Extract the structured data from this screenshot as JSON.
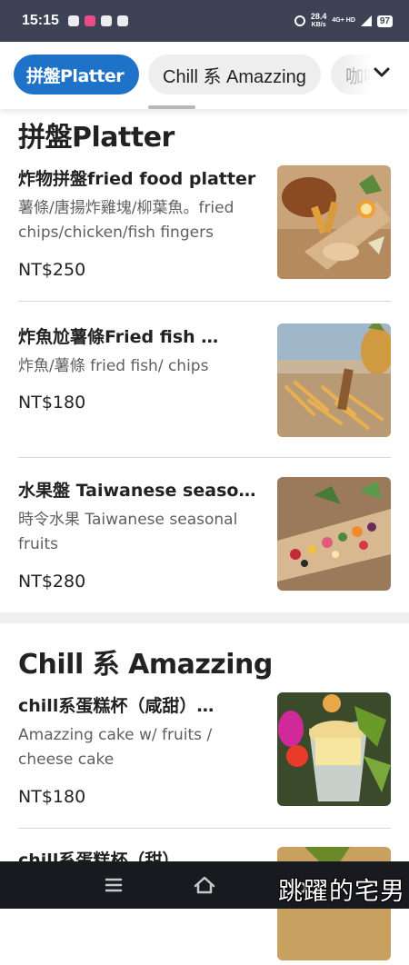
{
  "status_bar": {
    "time": "15:15",
    "net_speed_value": "28.4",
    "net_speed_unit": "KB/s",
    "network": "4G+ HD",
    "battery": "97"
  },
  "categories": {
    "active": "拼盤Platter",
    "second": "Chill 系 Amazzing",
    "third_partial": "咖啡"
  },
  "sections": [
    {
      "title": "拼盤Platter",
      "items": [
        {
          "name": "炸物拼盤fried food platter",
          "desc": "薯條/唐揚炸雞塊/柳葉魚。fried chips/chicken/fish fingers",
          "price": "NT$250"
        },
        {
          "name": "炸魚尬薯條Fried fish & chips",
          "desc": "炸魚/薯條 fried fish/ chips",
          "price": "NT$180"
        },
        {
          "name": "水果盤 Taiwanese seasonal fruits",
          "desc": "時令水果 Taiwanese seasonal fruits",
          "price": "NT$280"
        }
      ]
    },
    {
      "title": "Chill 系 Amazzing",
      "items": [
        {
          "name": "chill系蛋糕杯（咸甜）Amazzing cake",
          "desc": "Amazzing cake w/ fruits / cheese cake",
          "price": "NT$180"
        },
        {
          "name": "chill系蛋糕杯（甜）Amazzing cake",
          "desc": "",
          "price": ""
        }
      ]
    }
  ],
  "watermark": "跳躍的宅男",
  "icons": {
    "more": "chevron-down-icon",
    "nav_menu": "menu-icon",
    "nav_home": "home-icon",
    "nav_back": "back-icon"
  },
  "colors": {
    "accent": "#1e73c8",
    "status_bar": "#3d4354",
    "nav_bar": "#181a1f"
  }
}
